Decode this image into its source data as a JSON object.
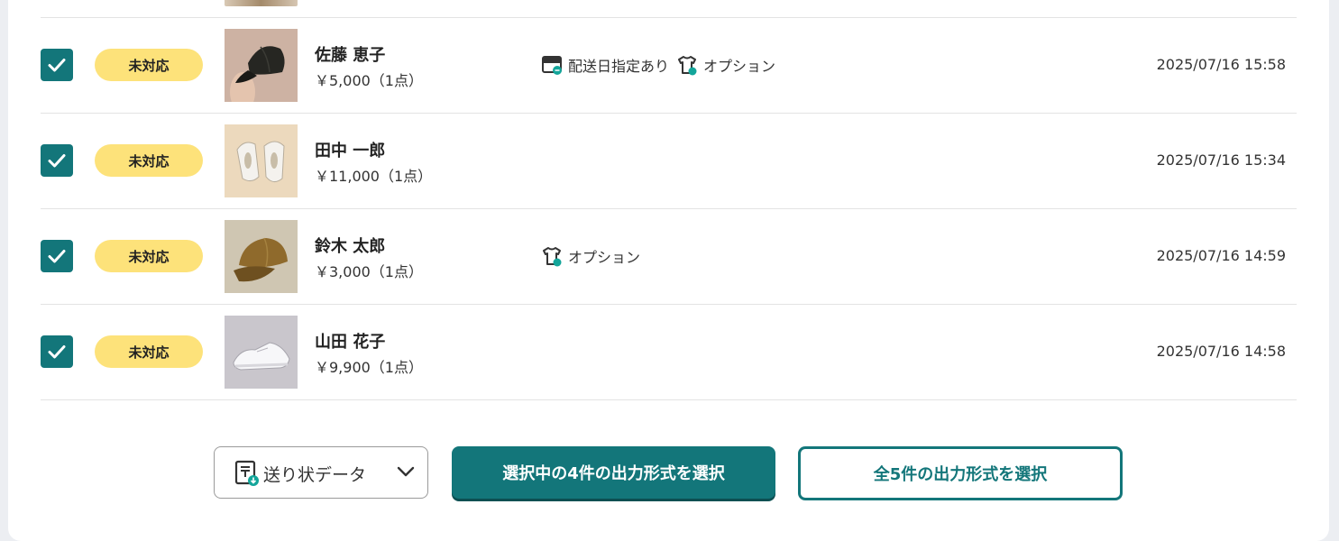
{
  "colors": {
    "accent": "#13767a",
    "status_badge": "#fde27a",
    "divider": "#e3e3e3",
    "background": "#eceef2"
  },
  "orders": [
    {
      "checked": true,
      "status": "未対応",
      "product_image": "black-cap",
      "customer": "佐藤 恵子",
      "price": "￥5,000（1点）",
      "tags": [
        {
          "icon": "delivery-date-icon",
          "label": "配送日指定あり"
        },
        {
          "icon": "option-shirt-icon",
          "label": "オプション"
        }
      ],
      "datetime": "2025/07/16 15:58"
    },
    {
      "checked": true,
      "status": "未対応",
      "product_image": "white-sneakers",
      "customer": "田中 一郎",
      "price": "￥11,000（1点）",
      "tags": [],
      "datetime": "2025/07/16 15:34"
    },
    {
      "checked": true,
      "status": "未対応",
      "product_image": "olive-cap",
      "customer": "鈴木 太郎",
      "price": "￥3,000（1点）",
      "tags": [
        {
          "icon": "option-shirt-icon",
          "label": "オプション"
        }
      ],
      "datetime": "2025/07/16 14:59"
    },
    {
      "checked": true,
      "status": "未対応",
      "product_image": "white-low-sneakers",
      "customer": "山田 花子",
      "price": "￥9,900（1点）",
      "tags": [],
      "datetime": "2025/07/16 14:58"
    }
  ],
  "footer": {
    "export_select": {
      "icon": "document-download-icon",
      "value": "送り状データ"
    },
    "export_selected_button": "選択中の4件の出力形式を選択",
    "export_all_button": "全5件の出力形式を選択"
  }
}
